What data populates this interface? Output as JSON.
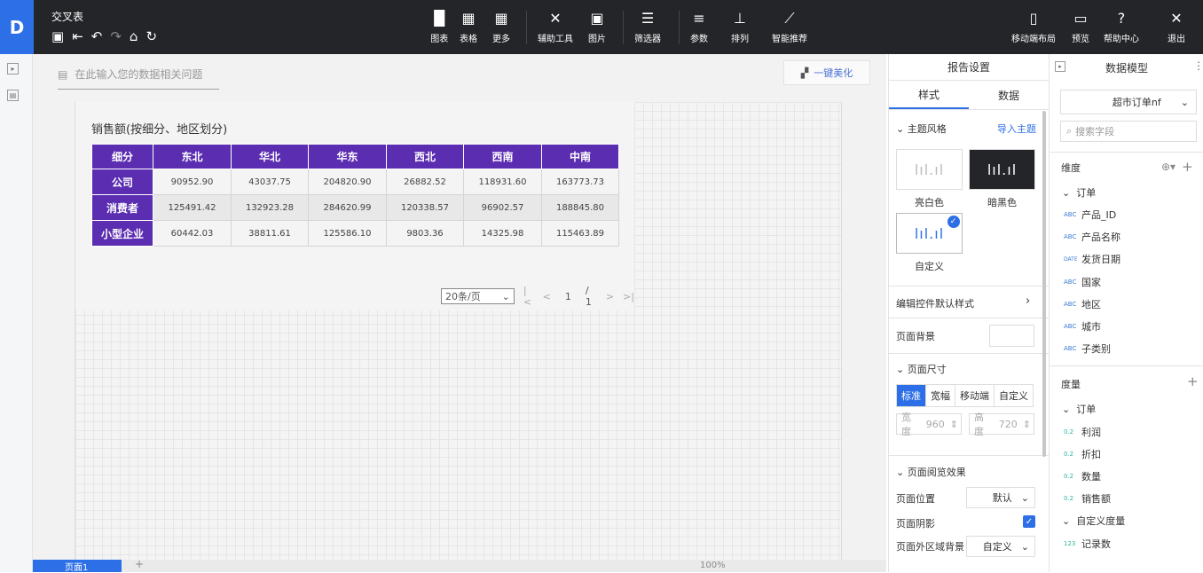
{
  "app": {
    "logo": "D",
    "doc_title": "交叉表"
  },
  "toolbar": {
    "quick_icons": [
      "save-icon",
      "exit-edit-icon",
      "undo-icon",
      "redo-icon",
      "format-painter-icon",
      "refresh-icon"
    ],
    "groups": [
      {
        "label": "图表",
        "icon": "▐▌"
      },
      {
        "label": "表格",
        "icon": "▦"
      },
      {
        "label": "更多",
        "icon": "▦"
      },
      {
        "label": "辅助工具",
        "icon": "✕"
      },
      {
        "label": "图片",
        "icon": "▣"
      },
      {
        "label": "筛选器",
        "icon": "☰"
      },
      {
        "label": "参数",
        "icon": "≡"
      },
      {
        "label": "排列",
        "icon": "⊥"
      },
      {
        "label": "智能推荐",
        "icon": "⟋"
      }
    ],
    "right": [
      {
        "label": "移动端布局",
        "icon": "▯"
      },
      {
        "label": "预览",
        "icon": "▭"
      },
      {
        "label": "帮助中心",
        "icon": "?"
      },
      {
        "label": "退出",
        "icon": "✕"
      }
    ]
  },
  "canvas": {
    "question_placeholder": "在此输入您的数据相关问题",
    "beautify_label": "一键美化",
    "chart_title": "销售额(按细分、地区划分)",
    "table": {
      "corner": "细分",
      "columns": [
        "东北",
        "华北",
        "华东",
        "西北",
        "西南",
        "中南"
      ],
      "rows": [
        {
          "label": "公司",
          "values": [
            "90952.90",
            "43037.75",
            "204820.90",
            "26882.52",
            "118931.60",
            "163773.73"
          ]
        },
        {
          "label": "消费者",
          "values": [
            "125491.42",
            "132923.28",
            "284620.99",
            "120338.57",
            "96902.57",
            "188845.80"
          ]
        },
        {
          "label": "小型企业",
          "values": [
            "60442.03",
            "38811.61",
            "125586.10",
            "9803.36",
            "14325.98",
            "115463.89"
          ]
        }
      ]
    },
    "pager": {
      "page_size": "20条/页",
      "current": "1",
      "total": "/ 1"
    }
  },
  "bottom": {
    "page_tab": "页面1",
    "zoom": "100%"
  },
  "settings": {
    "title": "报告设置",
    "tabs": [
      "样式",
      "数据"
    ],
    "theme_section": "主题风格",
    "import_theme": "导入主题",
    "themes": [
      {
        "label": "亮白色"
      },
      {
        "label": "暗黑色"
      },
      {
        "label": "自定义"
      }
    ],
    "edit_default_style": "编辑控件默认样式",
    "page_bg": "页面背景",
    "page_size_section": "页面尺寸",
    "size_options": [
      "标准",
      "宽幅",
      "移动端",
      "自定义"
    ],
    "width_label": "宽度",
    "width_value": "960",
    "height_label": "高度",
    "height_value": "720",
    "browse_section": "页面阅览效果",
    "position_label": "页面位置",
    "position_value": "默认",
    "shadow_label": "页面阴影",
    "outer_bg_label": "页面外区域背景",
    "outer_bg_value": "自定义"
  },
  "model": {
    "title": "数据模型",
    "dataset": "超市订单nf",
    "search_placeholder": "搜索字段",
    "dim_label": "维度",
    "dim_group": "订单",
    "dims": [
      {
        "type": "ABC",
        "name": "产品_ID"
      },
      {
        "type": "ABC",
        "name": "产品名称"
      },
      {
        "type": "DATE",
        "name": "发货日期"
      },
      {
        "type": "ABC",
        "name": "国家"
      },
      {
        "type": "ABC",
        "name": "地区"
      },
      {
        "type": "ABC",
        "name": "城市"
      },
      {
        "type": "ABC",
        "name": "子类别"
      }
    ],
    "measure_label": "度量",
    "measure_group": "订单",
    "measures": [
      {
        "type": "0.2",
        "name": "利润"
      },
      {
        "type": "0.2",
        "name": "折扣"
      },
      {
        "type": "0.2",
        "name": "数量"
      },
      {
        "type": "0.2",
        "name": "销售额"
      }
    ],
    "custom_group": "自定义度量",
    "custom_measures": [
      {
        "type": "123",
        "name": "记录数"
      }
    ]
  }
}
